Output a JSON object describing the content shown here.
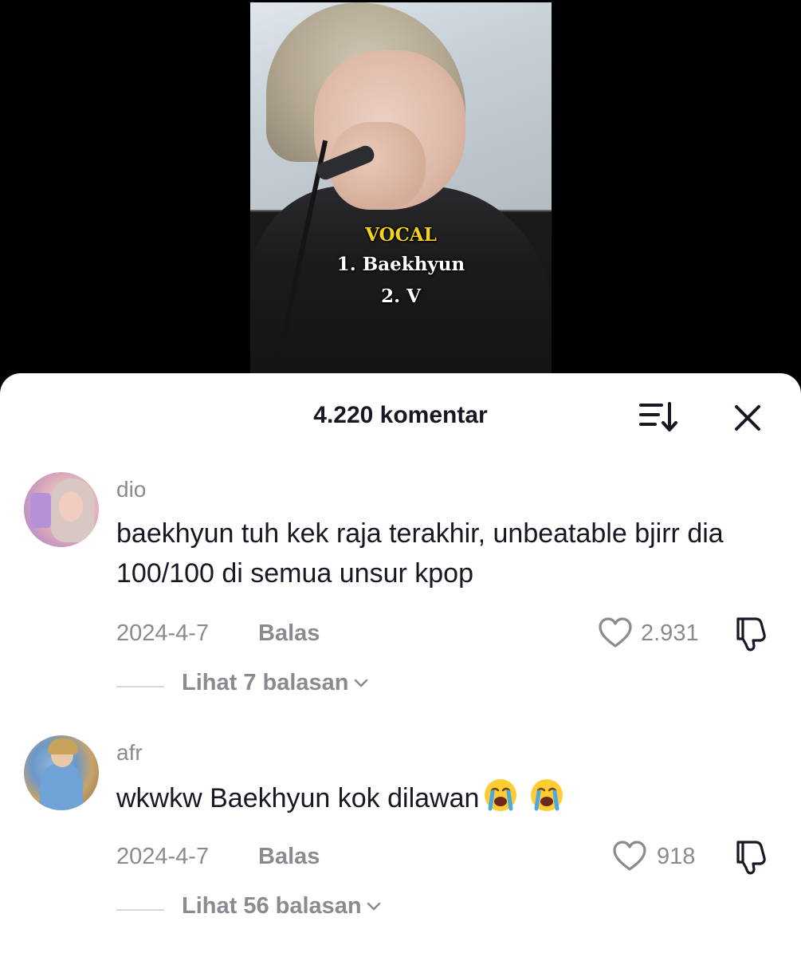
{
  "video": {
    "caption_title": "VOCAL",
    "caption_lines": [
      "1. Baekhyun",
      "2. V"
    ]
  },
  "comments_sheet": {
    "title": "4.220 komentar",
    "sort_icon": "sort-icon",
    "close_icon": "close-icon"
  },
  "comments": [
    {
      "username": "dio",
      "text": "baekhyun tuh kek raja terakhir, unbeatable bjirr dia 100/100 di semua unsur kpop",
      "date": "2024-4-7",
      "reply_label": "Balas",
      "likes": "2.931",
      "view_replies": "Lihat 7 balasan"
    },
    {
      "username": "afr",
      "text": "wkwkw Baekhyun kok dilawan",
      "emojis": [
        "loudly-crying-face",
        "loudly-crying-face"
      ],
      "date": "2024-4-7",
      "reply_label": "Balas",
      "likes": "918",
      "view_replies": "Lihat 56 balasan"
    }
  ],
  "colors": {
    "caption_title": "#f4d21c",
    "text_primary": "#161823",
    "text_secondary": "#8a8b91"
  }
}
